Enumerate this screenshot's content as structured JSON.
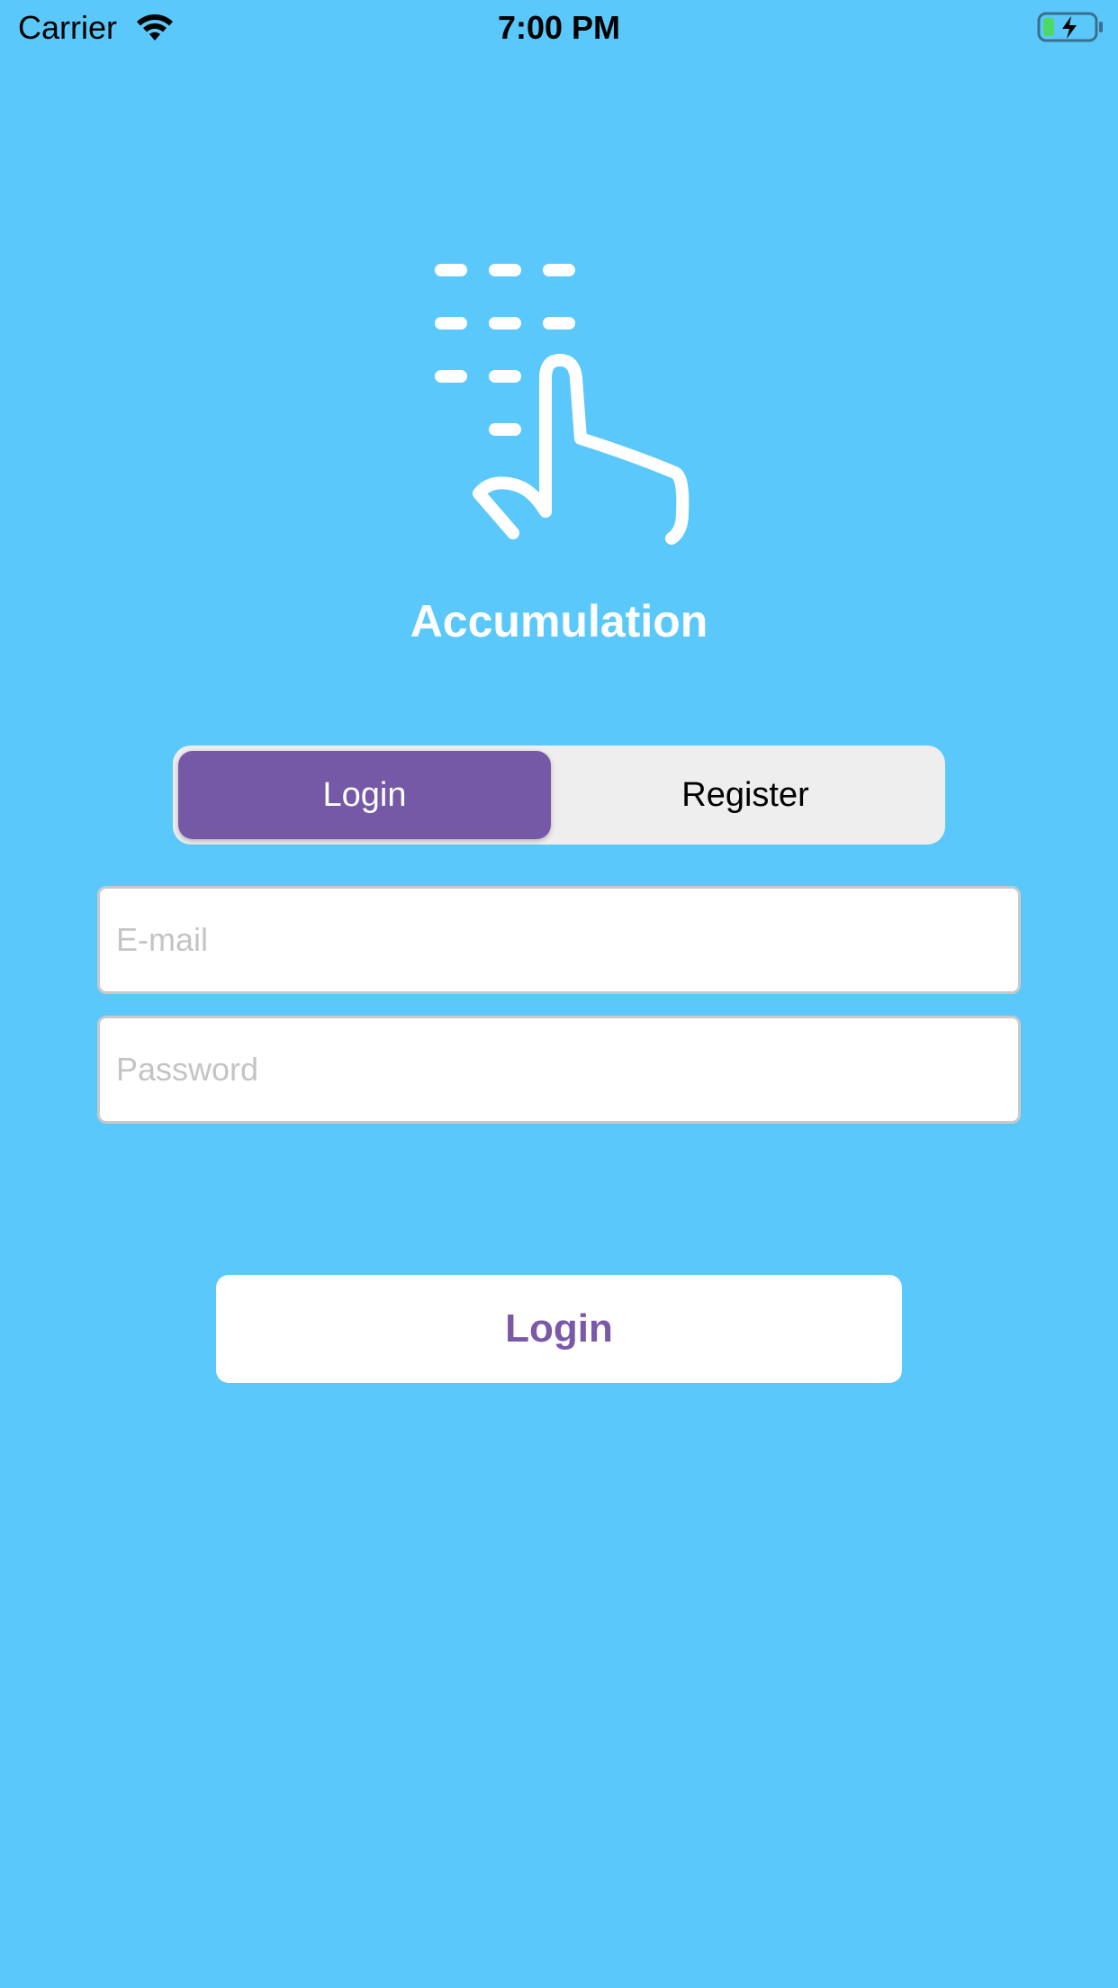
{
  "status_bar": {
    "carrier": "Carrier",
    "time": "7:00 PM",
    "wifi_icon": "wifi-icon",
    "battery_icon": "battery-charging-icon"
  },
  "app": {
    "logo_icon": "hand-pointer-tap-icon",
    "title": "Accumulation"
  },
  "segmented_control": {
    "options": [
      "Login",
      "Register"
    ],
    "selected": "Login"
  },
  "form": {
    "email": {
      "value": "",
      "placeholder": "E-mail"
    },
    "password": {
      "value": "",
      "placeholder": "Password"
    },
    "submit_label": "Login"
  },
  "colors": {
    "background": "#5ac8fa",
    "accent": "#7559a7",
    "segmented_background": "#eeeeee",
    "battery_fill": "#4cd964"
  }
}
